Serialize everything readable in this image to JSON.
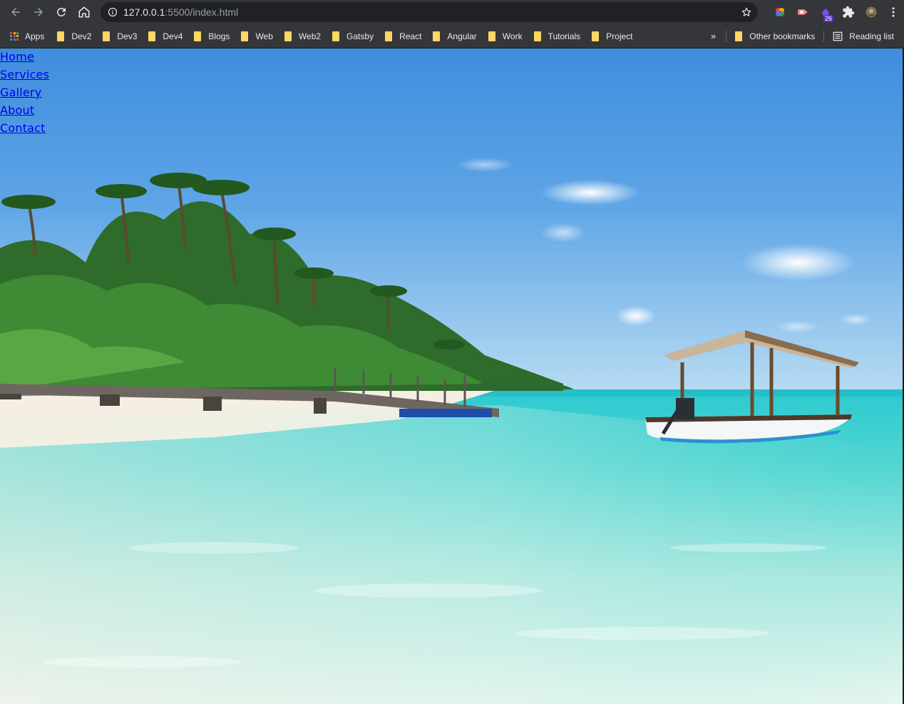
{
  "browser": {
    "url_host": "127.0.0.1",
    "url_rest": ":5500/index.html",
    "extension_badge": "26"
  },
  "bookmarks": {
    "apps_label": "Apps",
    "items": [
      "Dev2",
      "Dev3",
      "Dev4",
      "Blogs",
      "Web",
      "Web2",
      "Gatsby",
      "React",
      "Angular",
      "Work",
      "Tutorials",
      "Project"
    ],
    "overflow": "»",
    "other_label": "Other bookmarks",
    "reading_list_label": "Reading list"
  },
  "nav": {
    "links": [
      "Home",
      "Services",
      "Gallery",
      "About",
      "Contact"
    ]
  },
  "colors": {
    "chrome_bg": "#35363a",
    "omnibox_bg": "#202124",
    "folder": "#fdd663",
    "link": "#0000ee"
  }
}
